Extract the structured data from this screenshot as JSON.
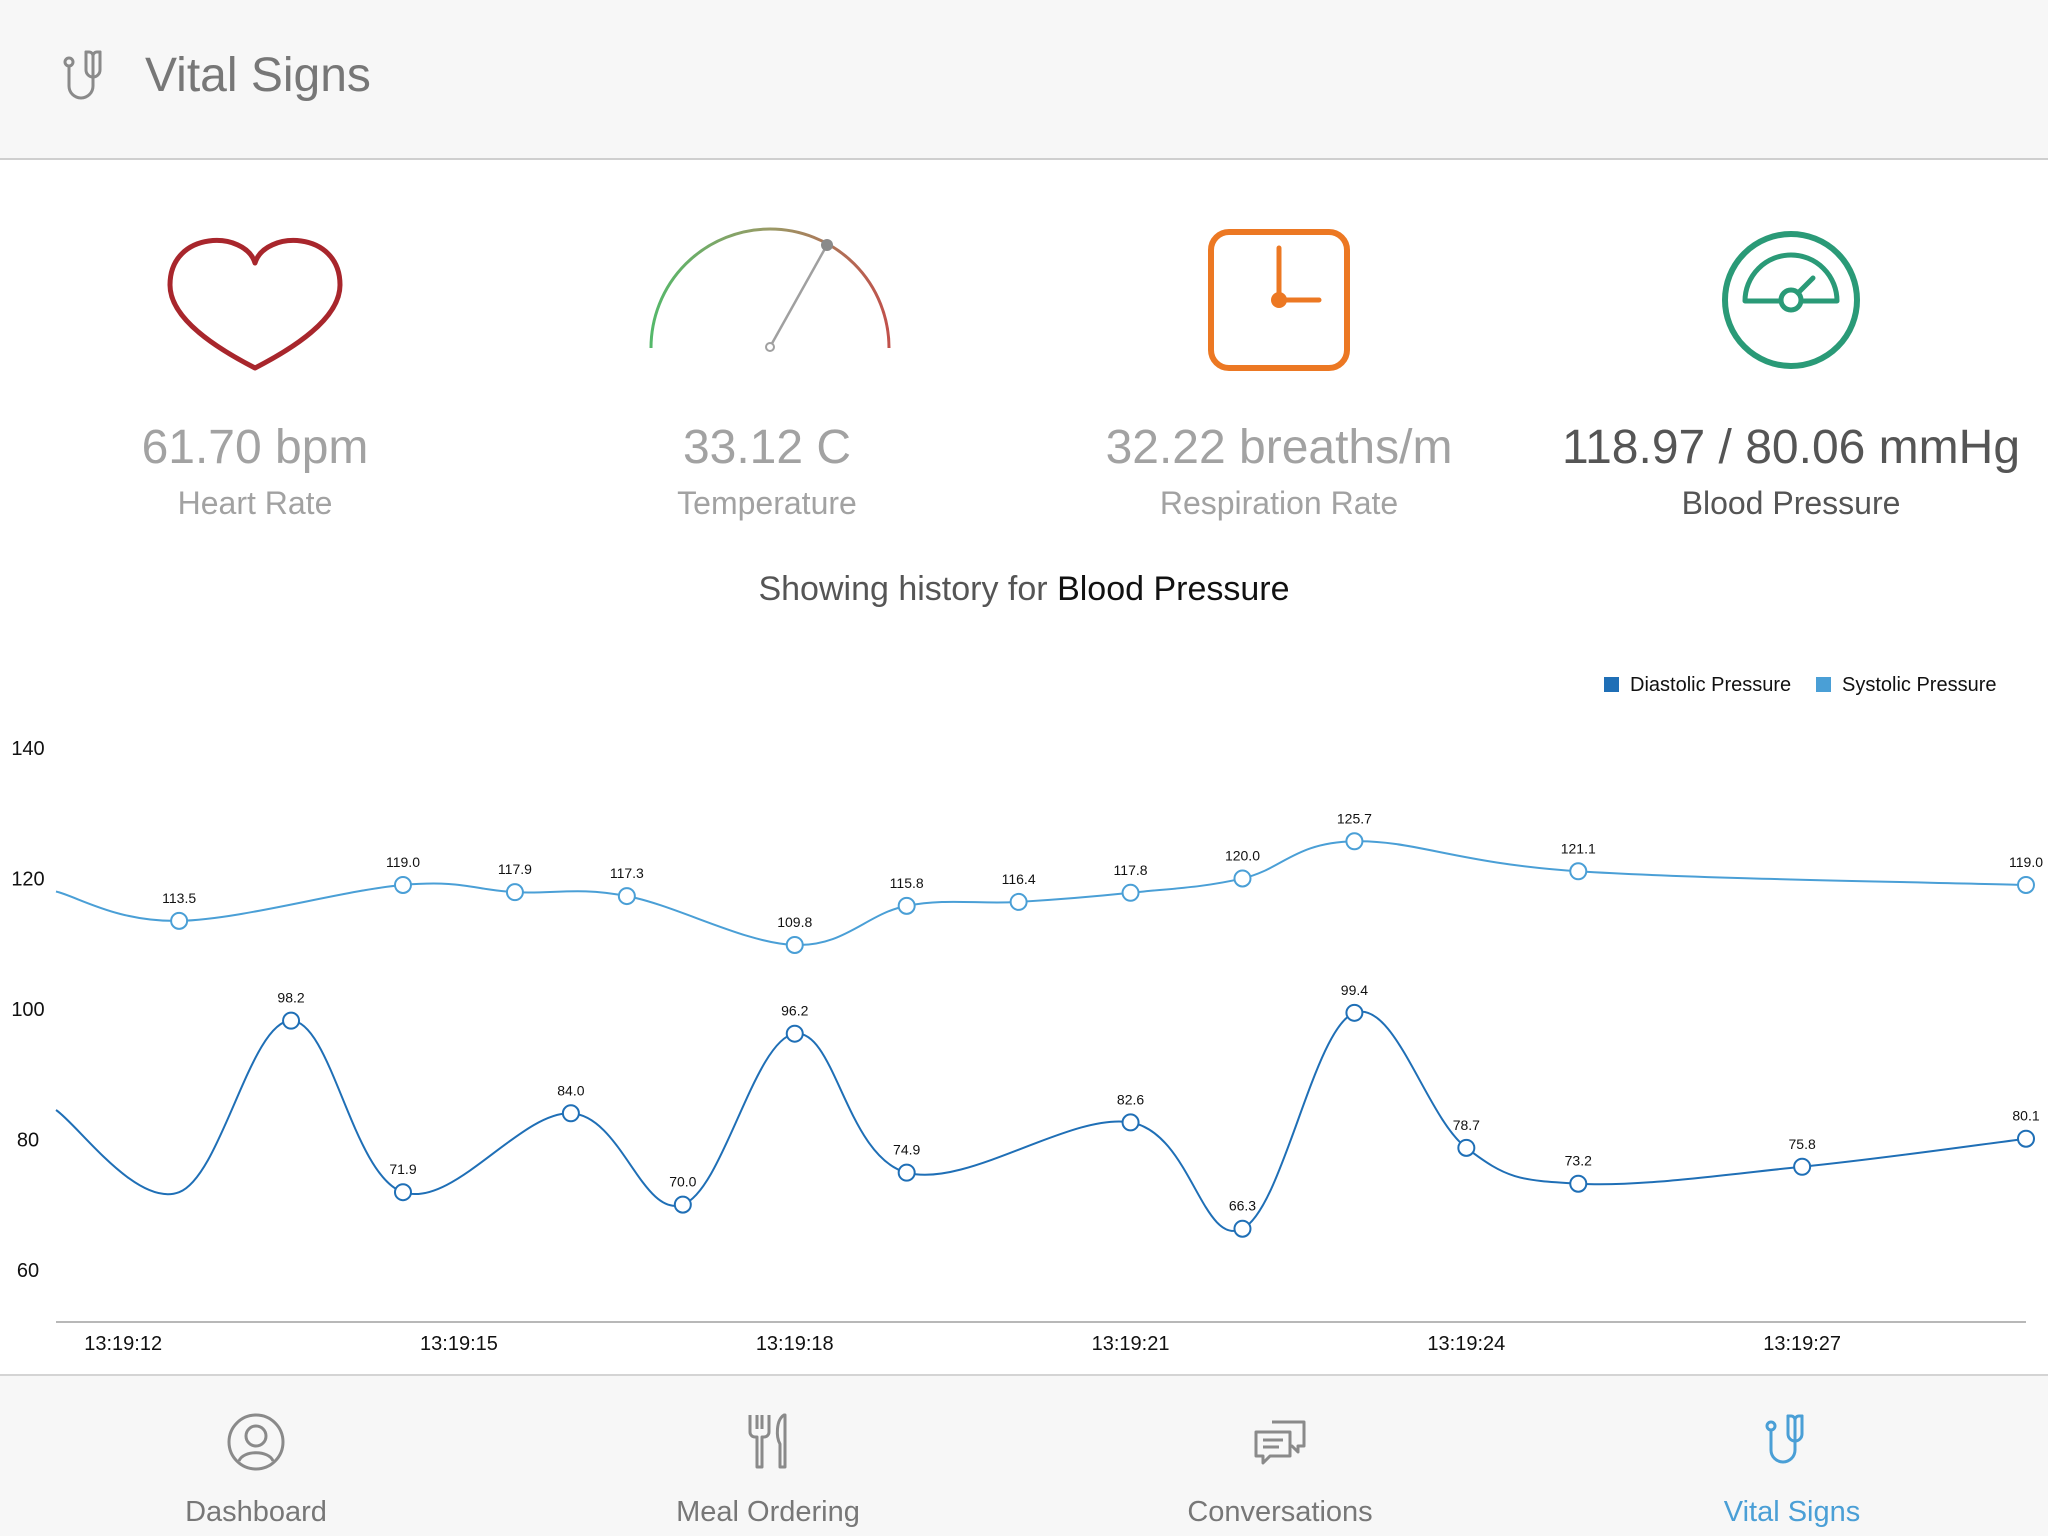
{
  "header": {
    "title": "Vital Signs",
    "icon": "stethoscope-icon"
  },
  "vitals": [
    {
      "value": "61.70 bpm",
      "label": "Heart Rate",
      "icon": "heart-icon",
      "color": "#a8262c"
    },
    {
      "value": "33.12 C",
      "label": "Temperature",
      "icon": "gauge-icon",
      "color": "#8c8c8c"
    },
    {
      "value": "32.22 breaths/m",
      "label": "Respiration Rate",
      "icon": "clock-icon",
      "color": "#ec7823"
    },
    {
      "value": "118.97 / 80.06 mmHg",
      "label": "Blood Pressure",
      "icon": "speedometer-icon",
      "color": "#2a9a77"
    }
  ],
  "history": {
    "prefix": "Showing history for",
    "metric": "Blood Pressure"
  },
  "chart_data": {
    "type": "line",
    "x_ticks": [
      "13:19:12",
      "13:19:15",
      "13:19:18",
      "13:19:21",
      "13:19:24",
      "13:19:27"
    ],
    "y_ticks": [
      60,
      80,
      100,
      120,
      140
    ],
    "ylim": [
      52,
      140
    ],
    "grid": false,
    "legend_position": "top-right",
    "series": [
      {
        "name": "Diastolic Pressure",
        "color": "#1f6fb6",
        "points": [
          [
            11.4,
            84.5
          ],
          [
            12.5,
            71.9
          ],
          [
            13.5,
            98.2
          ],
          [
            14.5,
            71.9
          ],
          [
            16.0,
            84.0
          ],
          [
            17.0,
            70.0
          ],
          [
            18.0,
            96.2
          ],
          [
            19.0,
            74.9
          ],
          [
            21.0,
            82.6
          ],
          [
            22.0,
            66.3
          ],
          [
            23.0,
            99.4
          ],
          [
            24.0,
            78.7
          ],
          [
            25.0,
            73.2
          ],
          [
            27.0,
            75.8
          ],
          [
            29.0,
            80.1
          ]
        ],
        "labels": [
          "",
          "",
          "98.2",
          "71.9",
          "84.0",
          "70.0",
          "96.2",
          "74.9",
          "82.6",
          "66.3",
          "99.4",
          "78.7",
          "73.2",
          "75.8",
          "80.1"
        ],
        "markers": [
          false,
          false,
          true,
          true,
          true,
          true,
          true,
          true,
          true,
          true,
          true,
          true,
          true,
          true,
          true
        ]
      },
      {
        "name": "Systolic Pressure",
        "color": "#4a9fd6",
        "points": [
          [
            11.4,
            118.0
          ],
          [
            12.5,
            113.5
          ],
          [
            14.5,
            119.0
          ],
          [
            15.5,
            117.9
          ],
          [
            16.5,
            117.3
          ],
          [
            18.0,
            109.8
          ],
          [
            19.0,
            115.8
          ],
          [
            20.0,
            116.4
          ],
          [
            21.0,
            117.8
          ],
          [
            22.0,
            120.0
          ],
          [
            23.0,
            125.7
          ],
          [
            25.0,
            121.1
          ],
          [
            29.0,
            119.0
          ]
        ],
        "labels": [
          "",
          "113.5",
          "119.0",
          "117.9",
          "117.3",
          "109.8",
          "115.8",
          "116.4",
          "117.8",
          "120.0",
          "125.7",
          "121.1",
          "119.0"
        ],
        "markers": [
          false,
          true,
          true,
          true,
          true,
          true,
          true,
          true,
          true,
          true,
          true,
          true,
          true
        ]
      }
    ]
  },
  "tabs": [
    {
      "label": "Dashboard",
      "icon": "user-circle-icon",
      "active": false
    },
    {
      "label": "Meal Ordering",
      "icon": "fork-knife-icon",
      "active": false
    },
    {
      "label": "Conversations",
      "icon": "chat-bubbles-icon",
      "active": false
    },
    {
      "label": "Vital Signs",
      "icon": "stethoscope-icon",
      "active": true
    }
  ]
}
